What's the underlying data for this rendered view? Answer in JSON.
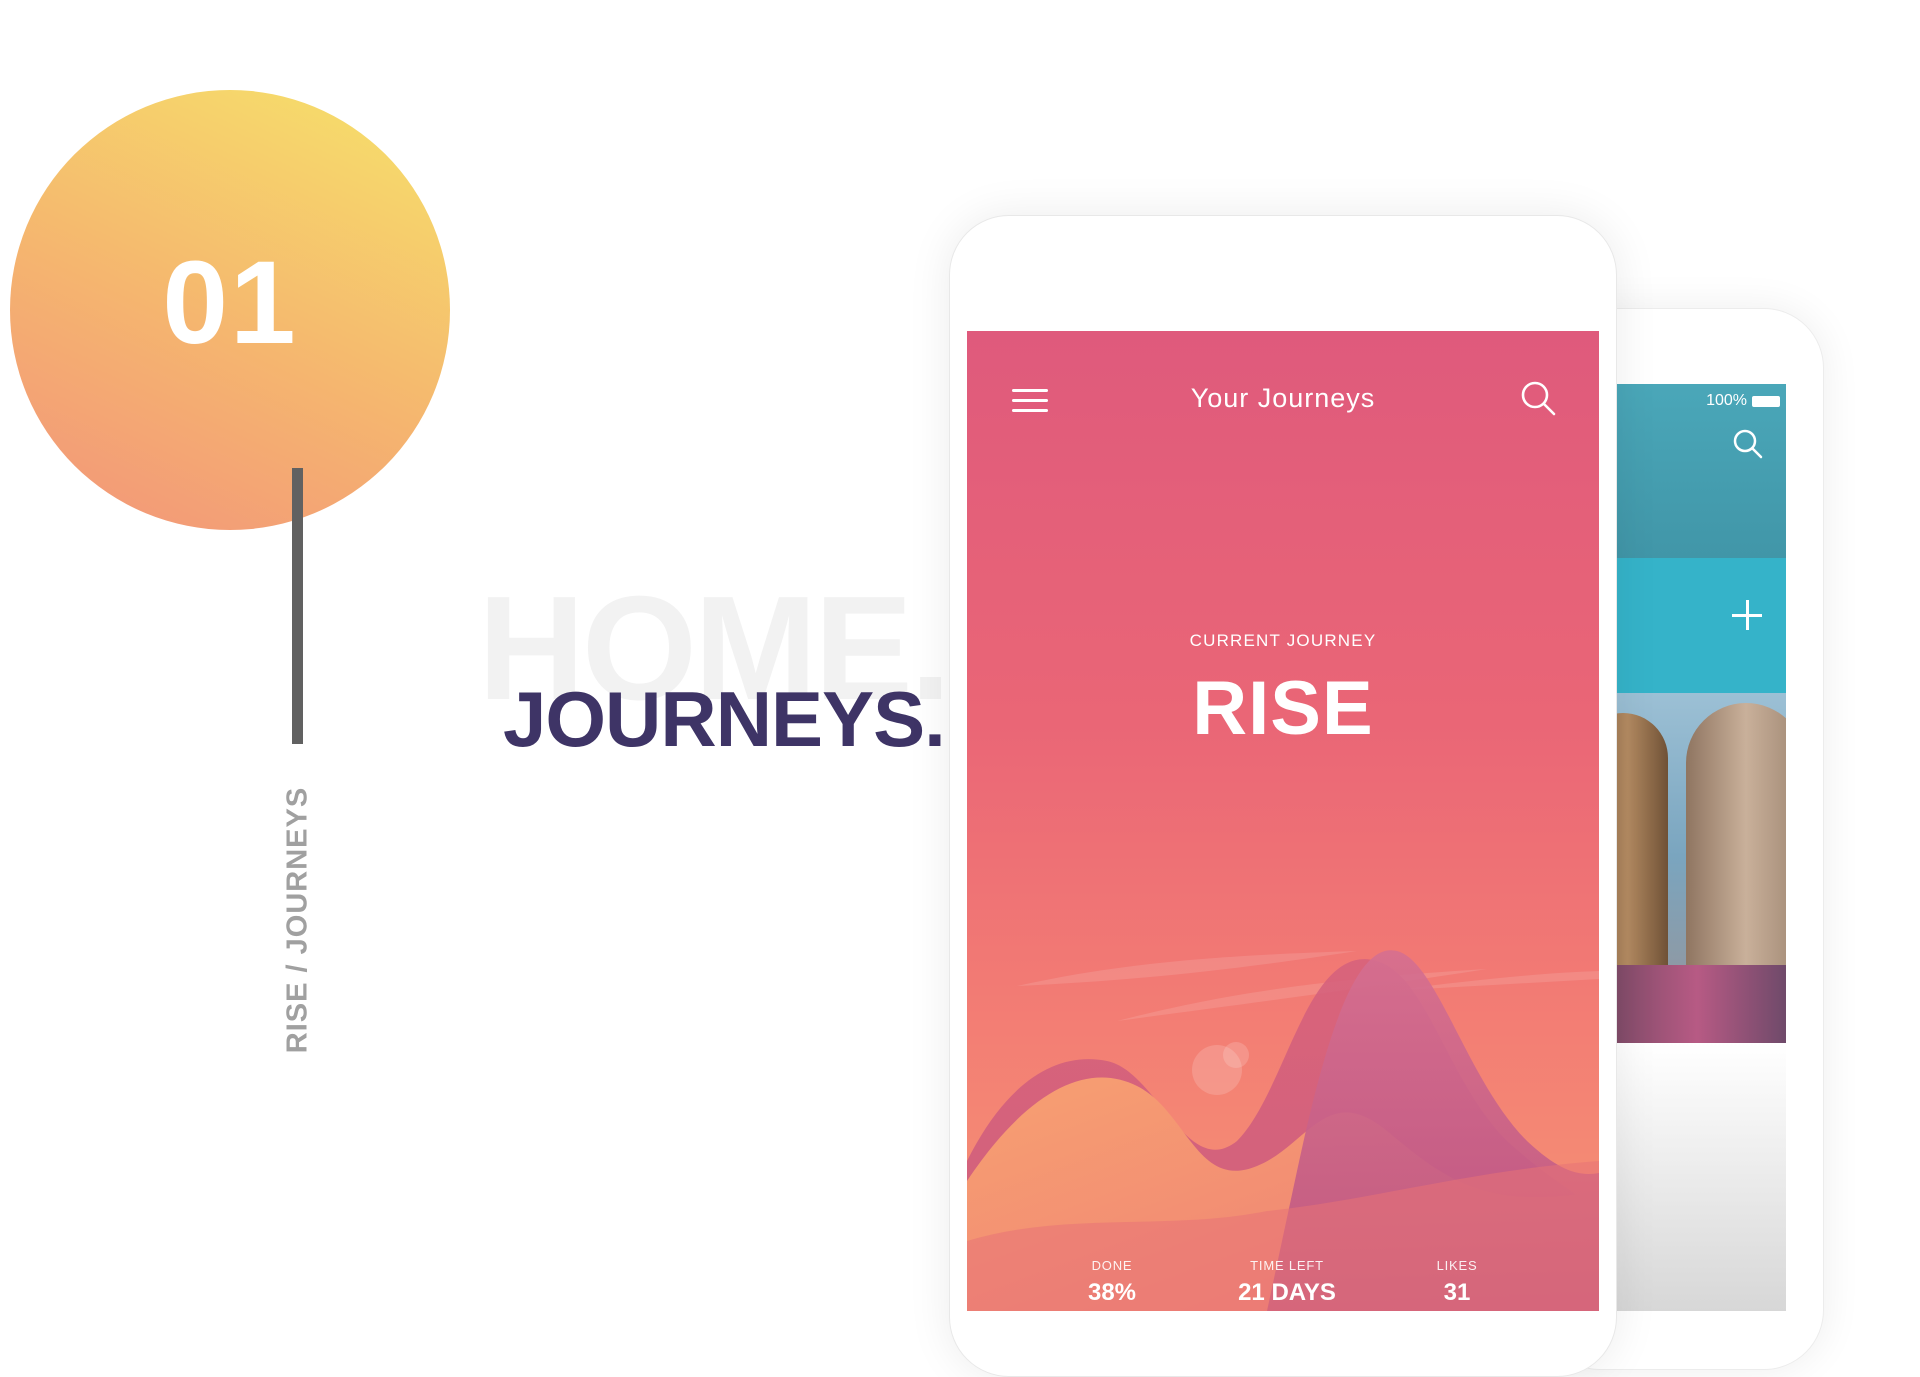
{
  "presentation": {
    "number": "01",
    "side_label": "RISE / JOURNEYS",
    "ghost_heading": "HOME.",
    "heading": "JOURNEYS."
  },
  "colors": {
    "badge_gradient": [
      "#f2937a",
      "#f6e36a"
    ],
    "heading": "#3e3466",
    "screen_gradient": [
      "#df5a7c",
      "#f59674"
    ],
    "back_teal": "#35b3c9"
  },
  "front_app": {
    "title": "Your Journeys",
    "menu_icon": "hamburger-menu-icon",
    "search_icon": "search-icon",
    "current_label": "CURRENT JOURNEY",
    "journey_name": "RISE",
    "stats": [
      {
        "label": "DONE",
        "value": "38%"
      },
      {
        "label": "TIME LEFT",
        "value": "21 DAYS"
      },
      {
        "label": "LIKES",
        "value": "31"
      }
    ]
  },
  "back_app": {
    "battery": "100%",
    "search_icon": "search-icon",
    "add_icon": "plus-icon"
  }
}
